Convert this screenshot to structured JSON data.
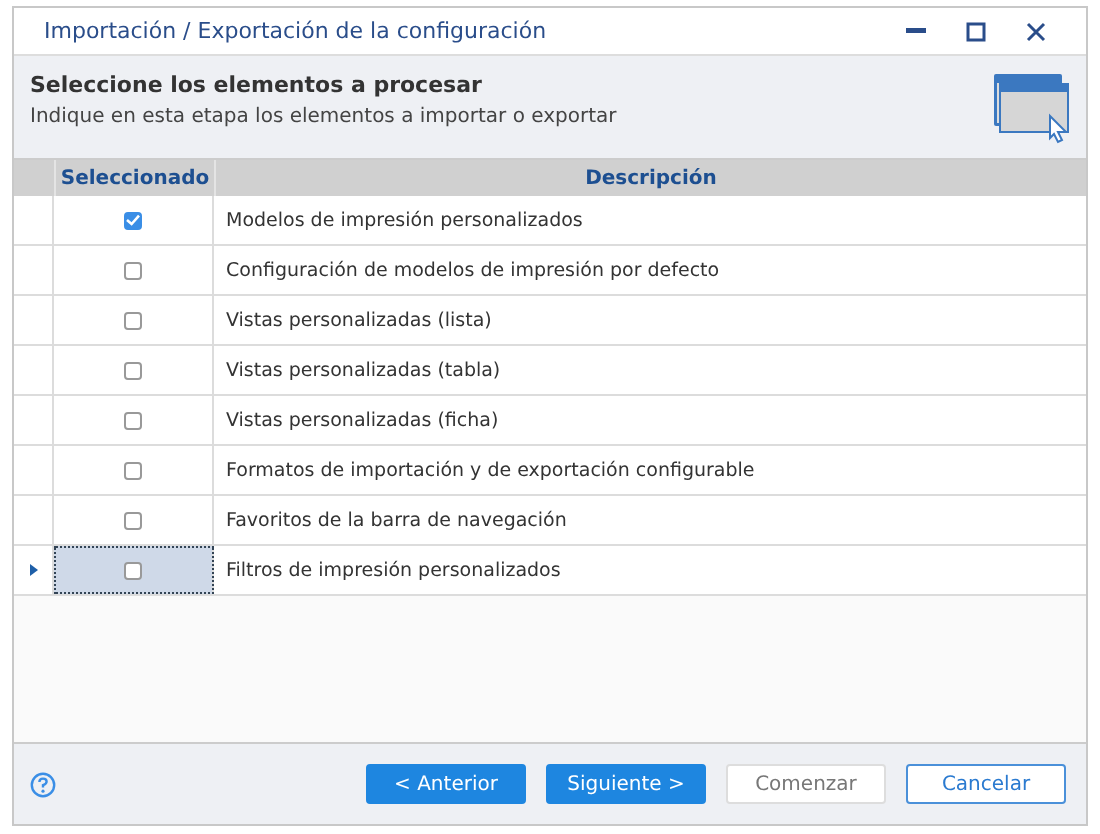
{
  "window": {
    "title": "Importación / Exportación de la configuración"
  },
  "header": {
    "title": "Seleccione los elementos a procesar",
    "subtitle": "Indique en esta etapa los elementos a importar o exportar"
  },
  "table": {
    "columns": [
      "Seleccionado",
      "Descripción"
    ],
    "rows": [
      {
        "checked": true,
        "current": false,
        "description": "Modelos de impresión personalizados"
      },
      {
        "checked": false,
        "current": false,
        "description": "Configuración de modelos de impresión por defecto"
      },
      {
        "checked": false,
        "current": false,
        "description": "Vistas personalizadas (lista)"
      },
      {
        "checked": false,
        "current": false,
        "description": "Vistas personalizadas (tabla)"
      },
      {
        "checked": false,
        "current": false,
        "description": "Vistas personalizadas (ficha)"
      },
      {
        "checked": false,
        "current": false,
        "description": "Formatos de importación y de exportación configurable"
      },
      {
        "checked": false,
        "current": false,
        "description": "Favoritos de la barra de navegación"
      },
      {
        "checked": false,
        "current": true,
        "description": "Filtros de impresión personalizados"
      }
    ]
  },
  "buttons": [
    {
      "label": "< Anterior",
      "kind": "primary",
      "disabled": false
    },
    {
      "label": "Siguiente >",
      "kind": "primary",
      "disabled": false
    },
    {
      "label": "Comenzar",
      "kind": "plain",
      "disabled": true
    },
    {
      "label": "Cancelar",
      "kind": "plain",
      "disabled": false
    }
  ]
}
